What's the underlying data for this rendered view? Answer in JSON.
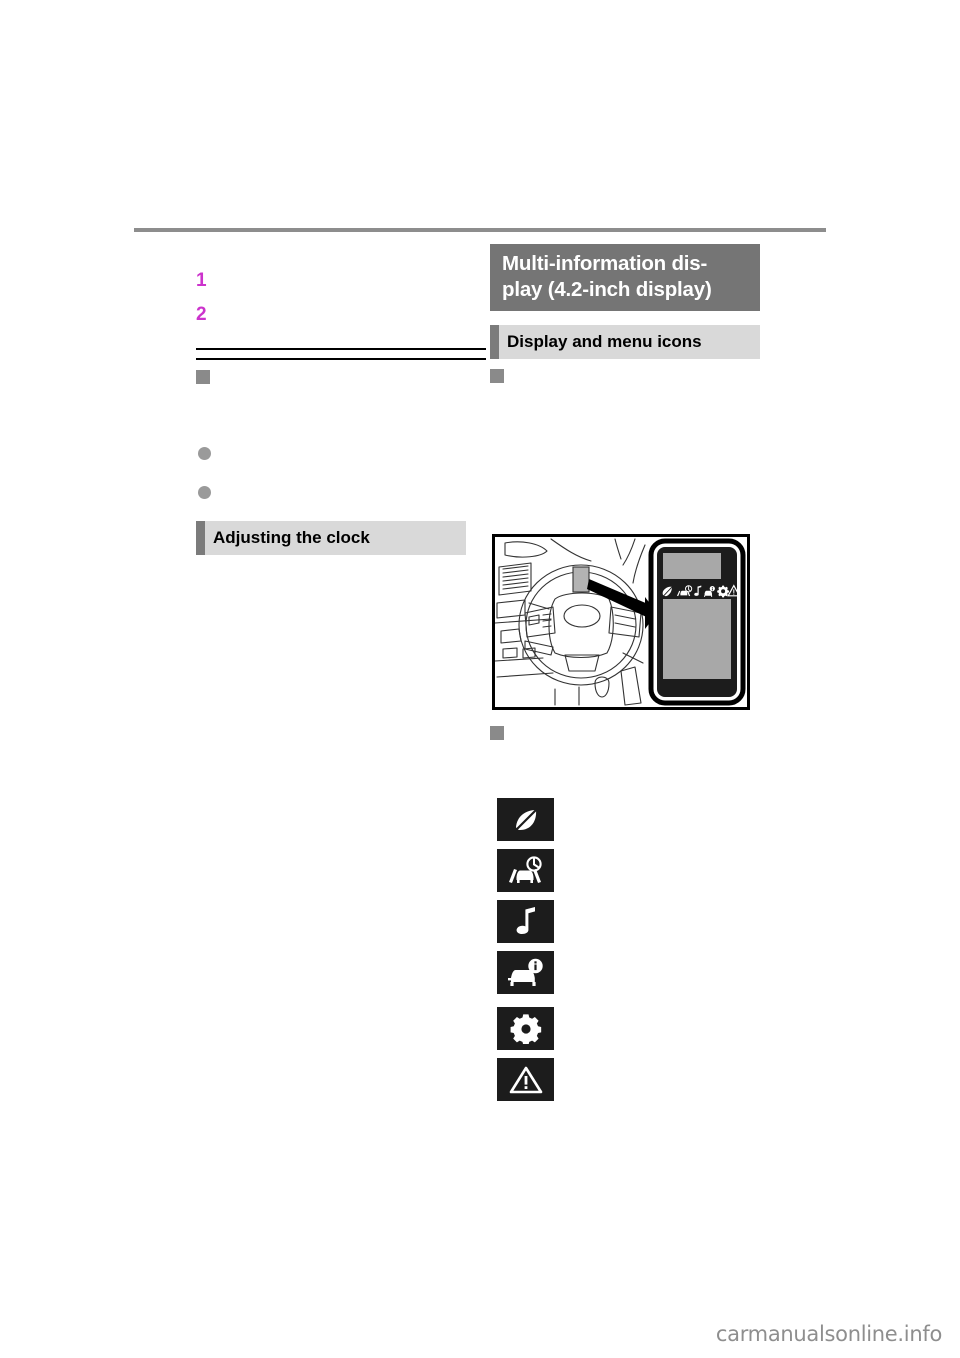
{
  "page": {
    "background_color": "#ffffff",
    "rule_color": "#8d8d8d",
    "accent_color": "#cc33cc"
  },
  "left_column": {
    "steps": [
      {
        "number": "1",
        "text": ""
      },
      {
        "number": "2",
        "text": ""
      }
    ],
    "note_heading": {
      "marker": "square",
      "label": ""
    },
    "bullets": [
      {
        "text": ""
      },
      {
        "text": ""
      }
    ],
    "subsection": {
      "label": "Adjusting the clock",
      "marker_color": "#7b7b7b",
      "background_color": "#d9d9d9"
    },
    "body_text": ""
  },
  "right_column": {
    "section_title": {
      "label": "Multi-information dis-play (4.2-inch display)",
      "line1": "Multi-information dis-",
      "line2": "play (4.2-inch display)",
      "background_color": "#757575",
      "text_color": "#ffffff"
    },
    "subsection": {
      "label": "Display and menu icons",
      "marker_color": "#7b7b7b",
      "background_color": "#d9d9d9"
    },
    "heading_a": {
      "marker": "square",
      "label": ""
    },
    "heading_b": {
      "marker": "square",
      "label": ""
    },
    "body_text": ""
  },
  "illustration": {
    "name": "steering-wheel-and-multi-information-display",
    "caption": "",
    "display_panel": {
      "icon_row": [
        "leaf-icon",
        "lane-departure-icon",
        "music-note-icon",
        "vehicle-info-icon",
        "gear-icon",
        "warning-triangle-icon"
      ]
    }
  },
  "menu_icons": [
    {
      "id": "leaf-icon",
      "name": "eco-driving-indicator",
      "description": ""
    },
    {
      "id": "lane-departure-icon",
      "name": "driving-support-icon",
      "description": ""
    },
    {
      "id": "music-note-icon",
      "name": "audio-icon",
      "description": ""
    },
    {
      "id": "vehicle-info-icon",
      "name": "vehicle-information-icon",
      "description": ""
    },
    {
      "id": "gear-icon",
      "name": "settings-icon",
      "description": ""
    },
    {
      "id": "warning-triangle-icon",
      "name": "warning-messages-icon",
      "description": ""
    }
  ],
  "footer": {
    "watermark": "carmanualsonline.info",
    "watermark_color": "#8e8e8e"
  }
}
